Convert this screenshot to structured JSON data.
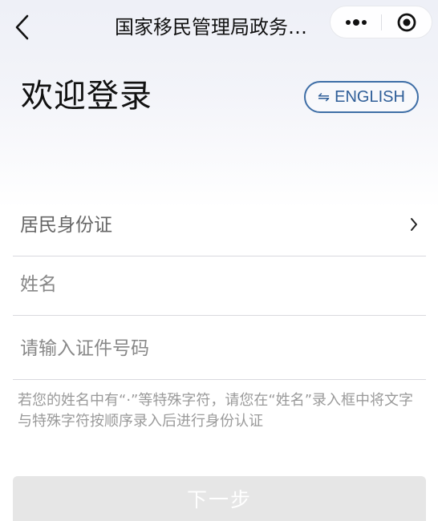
{
  "navbar": {
    "title": "国家移民管理局政务…",
    "back_icon": "chevron-left-icon",
    "more_icon": "more-dots-icon",
    "close_icon": "target-circle-icon"
  },
  "page": {
    "title": "欢迎登录",
    "language_button": "ENGLISH",
    "language_icon": "⇋"
  },
  "form": {
    "id_type": {
      "value": "居民身份证",
      "icon": "chevron-right-icon"
    },
    "name": {
      "placeholder": "姓名",
      "value": ""
    },
    "id_number": {
      "placeholder": "请输入证件号码",
      "value": ""
    },
    "hint": "若您的姓名中有“·”等特殊字符，请您在“姓名”录入框中将文字与特殊字符按顺序录入后进行身份认证"
  },
  "actions": {
    "next": "下一步"
  },
  "colors": {
    "accent": "#2f5e98",
    "disabled_button": "#e6e6e6",
    "placeholder": "#888888"
  }
}
